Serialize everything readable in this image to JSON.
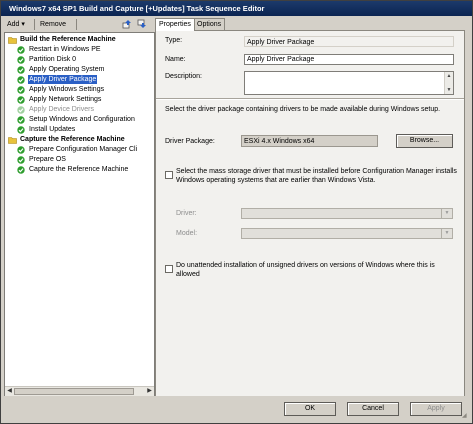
{
  "window": {
    "title": "Windows7 x64 SP1 Build and Capture [+Updates] Task Sequence Editor"
  },
  "toolbar": {
    "add_label": "Add",
    "remove_label": "Remove",
    "add_arrow": "▾"
  },
  "tree": {
    "items": [
      {
        "label": "Build the Reference Machine",
        "type": "group",
        "icon": "folder-icon"
      },
      {
        "label": "Restart in Windows PE",
        "type": "step",
        "icon": "check-icon"
      },
      {
        "label": "Partition Disk 0",
        "type": "step",
        "icon": "check-icon"
      },
      {
        "label": "Apply Operating System",
        "type": "step",
        "icon": "check-icon"
      },
      {
        "label": "Apply Driver Package",
        "type": "step",
        "icon": "check-icon",
        "selected": true
      },
      {
        "label": "Apply Windows Settings",
        "type": "step",
        "icon": "check-icon"
      },
      {
        "label": "Apply Network Settings",
        "type": "step",
        "icon": "check-icon"
      },
      {
        "label": "Apply Device Drivers",
        "type": "step",
        "icon": "check-icon",
        "disabled": true
      },
      {
        "label": "Setup Windows and Configuration",
        "type": "step",
        "icon": "check-icon"
      },
      {
        "label": "Install Updates",
        "type": "step",
        "icon": "check-icon"
      },
      {
        "label": "Capture the Reference Machine",
        "type": "group",
        "icon": "folder-icon"
      },
      {
        "label": "Prepare Configuration Manager Cli",
        "type": "step",
        "icon": "check-icon"
      },
      {
        "label": "Prepare OS",
        "type": "step",
        "icon": "check-icon"
      },
      {
        "label": "Capture the Reference Machine",
        "type": "step",
        "icon": "check-icon"
      }
    ]
  },
  "tabs": [
    {
      "label": "Properties",
      "active": true
    },
    {
      "label": "Options",
      "active": false
    }
  ],
  "properties": {
    "type_label": "Type:",
    "type_value": "Apply Driver Package",
    "name_label": "Name:",
    "name_value": "Apply Driver Package",
    "description_label": "Description:",
    "description_value": "",
    "instruction": "Select the driver package containing drivers to be made available during Windows setup.",
    "driver_package_label": "Driver Package:",
    "driver_package_value": "ESXi 4.x Windows x64",
    "browse_label": "Browse...",
    "mass_storage_text": "Select the mass storage driver that must be installed before Configuration Manager installs Windows operating systems that are earlier than Windows Vista.",
    "driver_label": "Driver:",
    "model_label": "Model:",
    "unsigned_text": "Do unattended installation of unsigned drivers on versions of Windows where this is allowed"
  },
  "buttons": {
    "ok_label": "OK",
    "cancel_label": "Cancel",
    "apply_label": "Apply"
  },
  "colors": {
    "title_bar": "#0b2451",
    "selection": "#2a5fc5",
    "check_green": "#2e9d2e",
    "folder_yellow": "#e8c23c"
  }
}
